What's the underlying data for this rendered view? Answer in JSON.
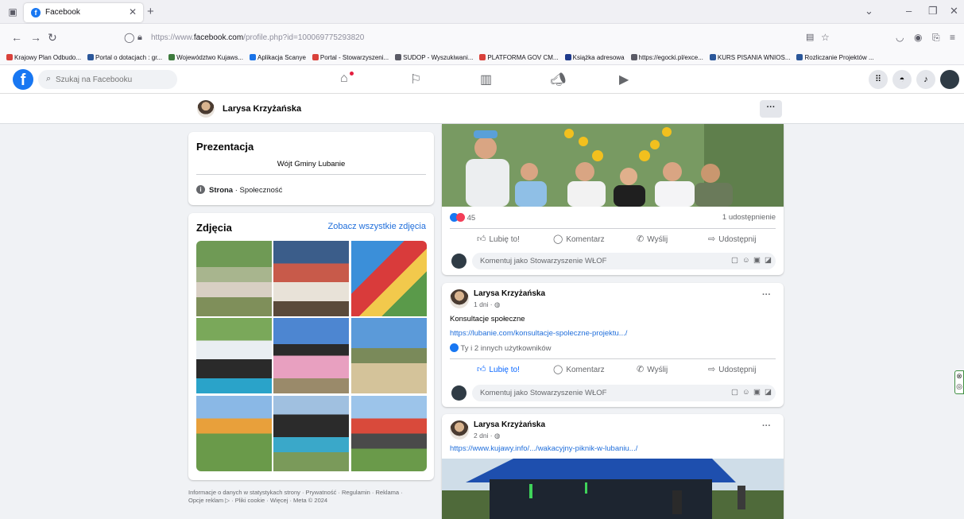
{
  "browser": {
    "tab_title": "Facebook",
    "url_prefix": "https://www.",
    "url_domain": "facebook.com",
    "url_path": "/profile.php?id=100069775293820",
    "bookmarks": [
      {
        "label": "Krajowy Plan Odbudo...",
        "color": "#d9413b"
      },
      {
        "label": "Portal o dotacjach : gr...",
        "color": "#2b579a"
      },
      {
        "label": "Województwo Kujaws...",
        "color": "#3d7a3d"
      },
      {
        "label": "Aplikacja Scanye",
        "color": "#1a73e8"
      },
      {
        "label": "Portal - Stowarzyszeni...",
        "color": "#d9413b"
      },
      {
        "label": "SUDOP - Wyszukiwani...",
        "color": "#5b5b66"
      },
      {
        "label": "PLATFORMA GOV CM...",
        "color": "#d9413b"
      },
      {
        "label": "Książka adresowa",
        "color": "#1f3b8c"
      },
      {
        "label": "https://egocki.pl/exce...",
        "color": "#5b5b66"
      },
      {
        "label": "KURS PISANIA WNIOS...",
        "color": "#2b579a"
      },
      {
        "label": "Rozliczanie Projektów ...",
        "color": "#2b579a"
      }
    ]
  },
  "fb": {
    "search_placeholder": "Szukaj na Facebooku",
    "brand_color": "#1877f2"
  },
  "profile": {
    "name": "Larysa Krzyżańska",
    "more": "···"
  },
  "intro": {
    "heading": "Prezentacja",
    "bio": "Wójt Gminy Lubanie",
    "info_bold": "Strona",
    "info_rest": " · Społeczność"
  },
  "photos": {
    "heading": "Zdjęcia",
    "see_all": "Zobacz wszystkie zdjęcia"
  },
  "footer": {
    "line1": "Informacje o danych w statystykach strony · Prywatność · Regulamin · Reklama ·",
    "line2": "Opcje reklam ▷ · Pliki cookie · Więcej · Meta © 2024"
  },
  "post1": {
    "reactions_count": "45",
    "shares": "1 udostępnienie",
    "like": "Lubię to!",
    "comment": "Komentarz",
    "send": "Wyślij",
    "share": "Udostępnij",
    "comment_placeholder": "Komentuj jako Stowarzyszenie WŁOF"
  },
  "post2": {
    "author": "Larysa Krzyżańska",
    "time": "1 dni · ",
    "text": "Konsultacje społeczne",
    "link": "https://lubanie.com/konsultacje-spoleczne-projektu.../",
    "likes_text": "Ty i 2 innych użytkowników",
    "like": "Lubię to!",
    "comment": "Komentarz",
    "send": "Wyślij",
    "share": "Udostępnij",
    "comment_placeholder": "Komentuj jako Stowarzyszenie WŁOF"
  },
  "post3": {
    "author": "Larysa Krzyżańska",
    "time": "2 dni · ",
    "link": "https://www.kujawy.info/.../wakacyjny-piknik-w-lubaniu.../"
  }
}
